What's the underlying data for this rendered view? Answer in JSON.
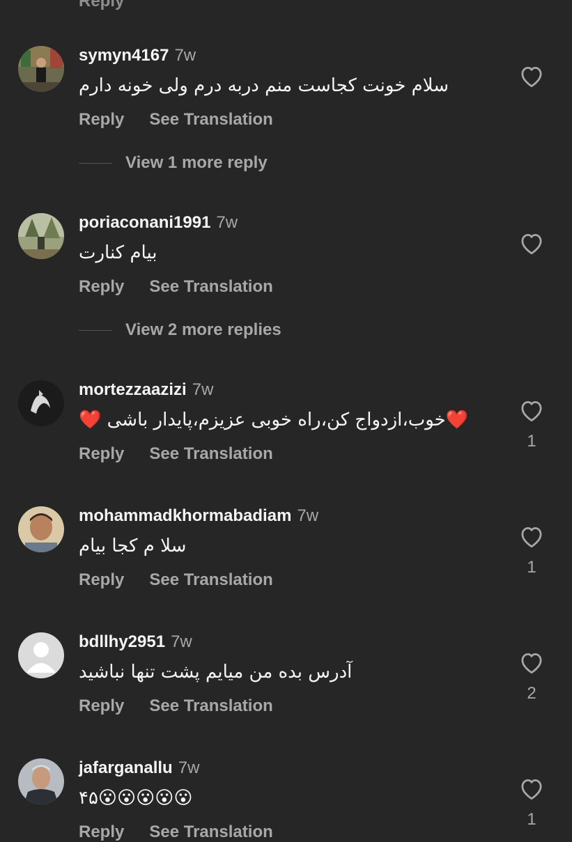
{
  "top_partial": "Reply",
  "actions": {
    "reply": "Reply",
    "see_translation": "See Translation"
  },
  "comments": [
    {
      "username": "symyn4167",
      "time": "7w",
      "text": "سلام خونت کجاست منم دربه درم ولی خونه دارم",
      "likes": "",
      "view_replies": "View 1 more reply"
    },
    {
      "username": "poriaconani1991",
      "time": "7w",
      "text": "بیام کنارت",
      "likes": "",
      "view_replies": "View 2 more replies"
    },
    {
      "username": "mortezzaazizi",
      "time": "7w",
      "text": "❤️خوب،ازدواج کن،راه خوبی عزیزم،پایدار باشی ❤️",
      "likes": "1",
      "view_replies": ""
    },
    {
      "username": "mohammadkhormabadiam",
      "time": "7w",
      "text": "سلا م کجا بیام",
      "likes": "1",
      "view_replies": ""
    },
    {
      "username": "bdllhy2951",
      "time": "7w",
      "text": "آدرس بده من میایم پشت تنها نباشید",
      "likes": "2",
      "view_replies": ""
    },
    {
      "username": "jafarganallu",
      "time": "7w",
      "text": "۴۵😮😮😮😮😮",
      "likes": "1",
      "view_replies": ""
    }
  ],
  "icons": {
    "like": "heart-outline-icon"
  },
  "colors": {
    "background": "#262626",
    "text": "#f5f5f5",
    "muted": "#a8a8a8"
  }
}
